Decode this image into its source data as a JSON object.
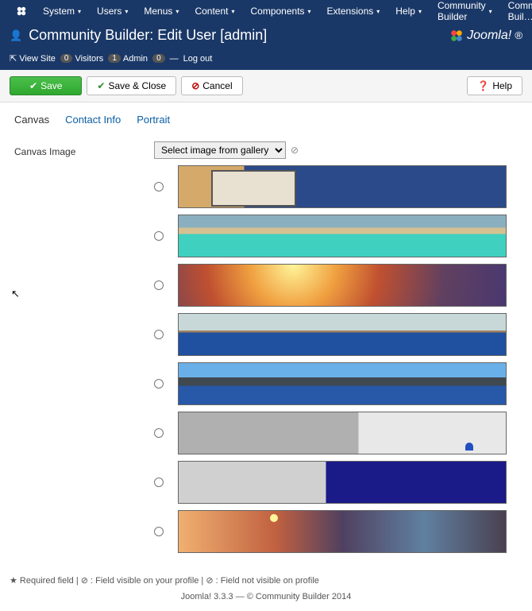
{
  "topmenu": {
    "items": [
      {
        "label": "System"
      },
      {
        "label": "Users"
      },
      {
        "label": "Menus"
      },
      {
        "label": "Content"
      },
      {
        "label": "Components"
      },
      {
        "label": "Extensions"
      },
      {
        "label": "Help"
      },
      {
        "label": "Community Builder"
      }
    ],
    "right_app": "Community Buil…"
  },
  "header": {
    "title": "Community Builder: Edit User [admin]",
    "logo_text": "Joomla!"
  },
  "subbar": {
    "view_site": "View Site",
    "visitors_label": "Visitors",
    "visitors_count": "0",
    "admin_label": "Admin",
    "admin_count": "1",
    "msg_count": "0",
    "logout": "Log out"
  },
  "toolbar": {
    "save": "Save",
    "save_close": "Save & Close",
    "cancel": "Cancel",
    "help": "Help"
  },
  "tabs": {
    "canvas": "Canvas",
    "contact": "Contact Info",
    "portrait": "Portrait"
  },
  "field": {
    "label": "Canvas Image",
    "select_label": "Select image from gallery"
  },
  "legend": "★ Required field | ⊘ : Field visible on your profile | ⊘ : Field not visible on profile",
  "footer": "Joomla! 3.3.3  —  © Community Builder 2014"
}
